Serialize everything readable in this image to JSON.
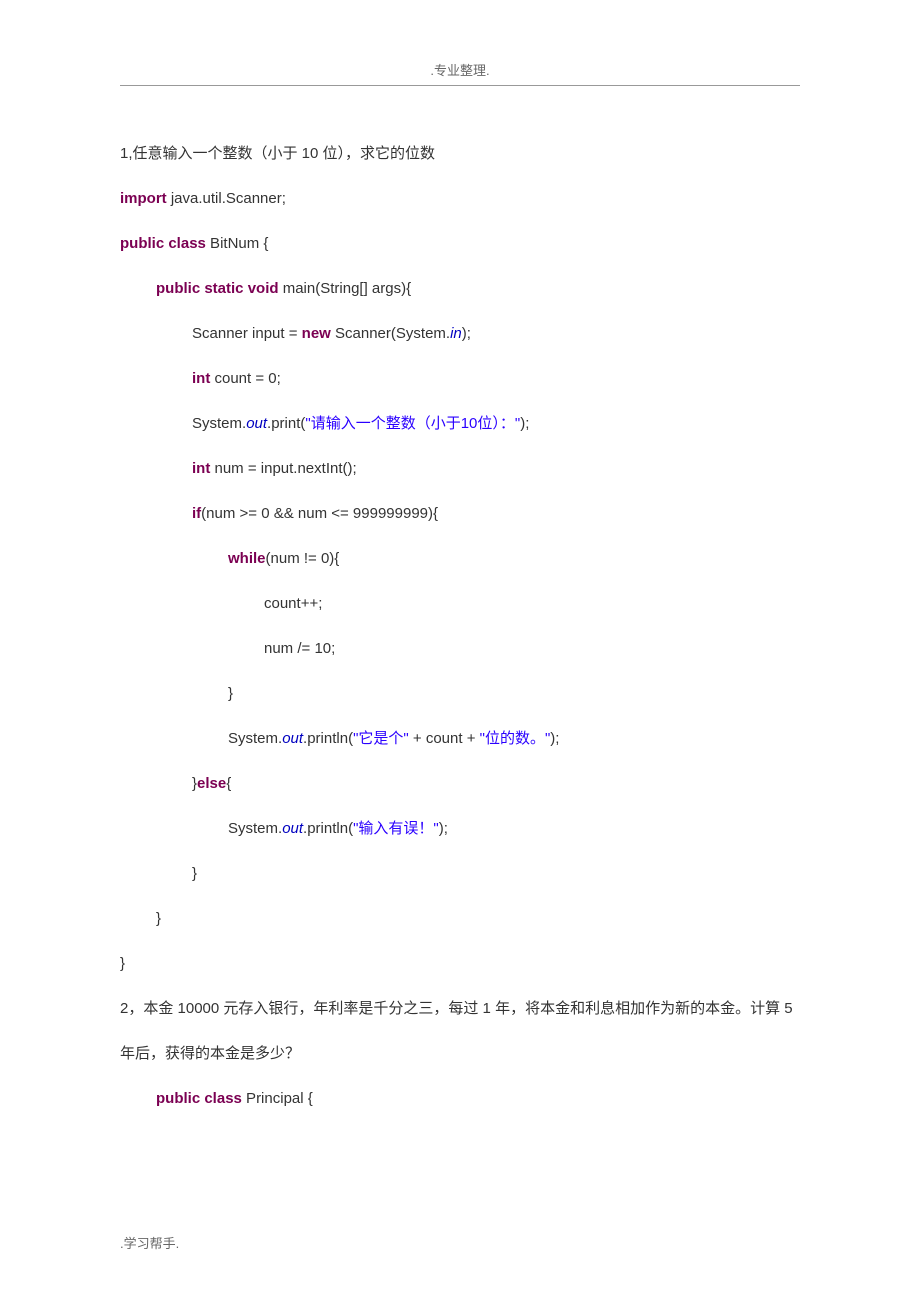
{
  "header_text": ".专业整理.",
  "footer_text": ".学习帮手.",
  "problem1_desc": "1,任意输入一个整数（小于 10 位），求它的位数",
  "problem2_desc": "2，本金 10000 元存入银行，年利率是千分之三，每过 1 年，将本金和利息相加作为新的本金。计算 5 年后，获得的本金是多少？",
  "code1": {
    "import_kw": "import",
    "import_stmt": " java.util.Scanner;",
    "public_kw": "public",
    "class_kw": "class",
    "class_name": " BitNum {",
    "static_kw": "static",
    "void_kw": "void",
    "main_sig": " main(String[] args){",
    "scanner_decl_pre": "Scanner input = ",
    "new_kw": "new",
    "scanner_decl_post": " Scanner(System.",
    "in_field": "in",
    "scanner_end": ");",
    "int_kw": "int",
    "count_decl": " count = 0;",
    "system_pre": "System.",
    "out_field": "out",
    "print_method": ".print(",
    "prompt_str": "\"请输入一个整数（小于10位）：\"",
    "print_end": ");",
    "num_decl": " num = input.nextInt();",
    "if_kw": "if",
    "if_cond": "(num >= 0 && num <= 999999999){",
    "while_kw": "while",
    "while_cond": "(num != 0){",
    "count_incr": "count++;",
    "num_div": "num /= 10;",
    "close_brace": "}",
    "println_method": ".println(",
    "result_str1": "\"它是个\"",
    "result_concat": " + count + ",
    "result_str2": "\"位的数。\"",
    "println_end": ");",
    "else_kw": "else",
    "else_brace": "{",
    "error_str": "\"输入有误！\"",
    "close_else": "}"
  },
  "code2": {
    "public_kw": "public",
    "class_kw": "class",
    "class_name": " Principal {"
  }
}
